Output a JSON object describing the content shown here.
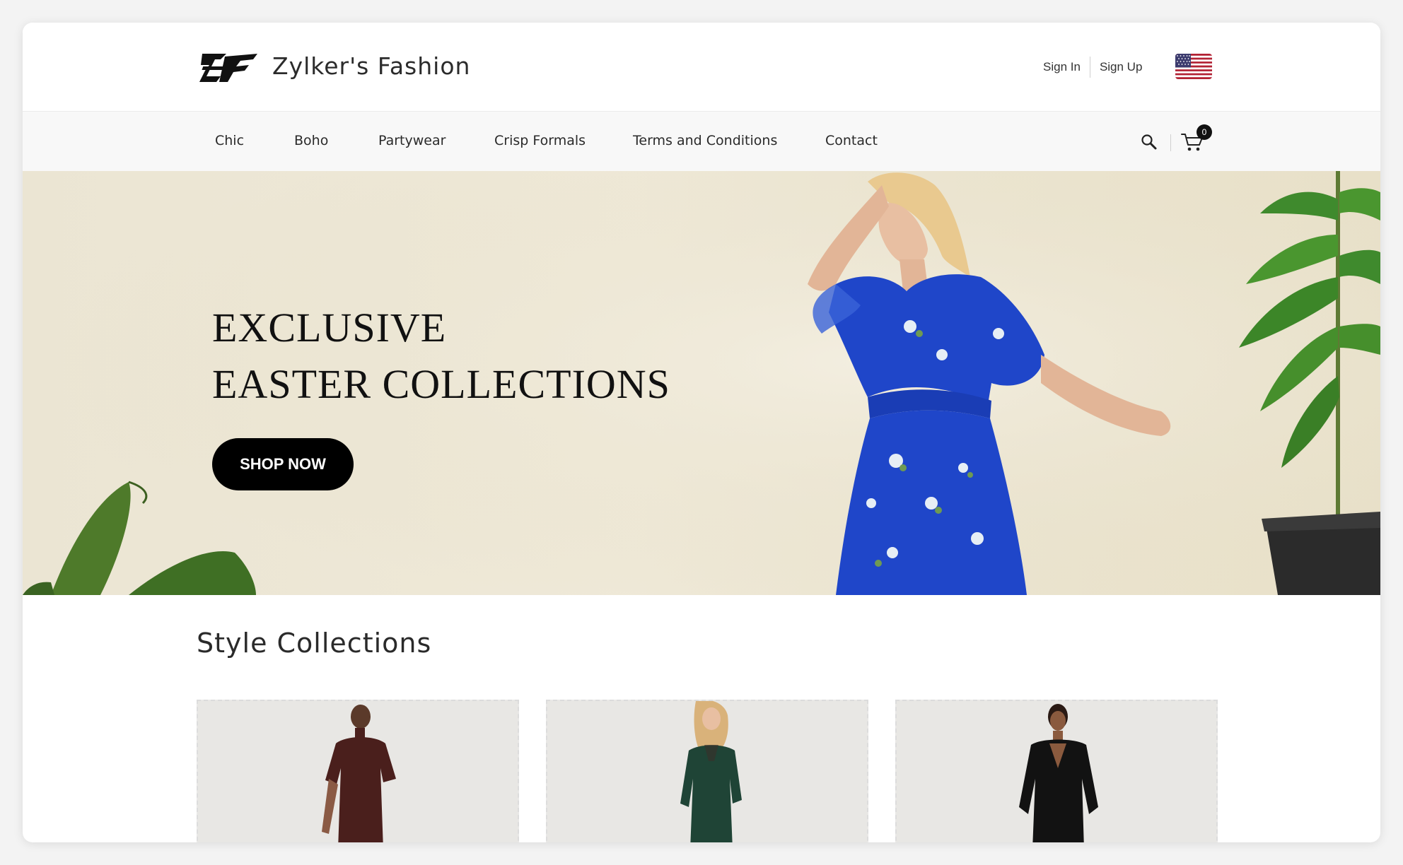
{
  "brand": {
    "name": "Zylker's Fashion",
    "logo_icon": "zf-monogram-logo"
  },
  "auth": {
    "sign_in": "Sign In",
    "sign_up": "Sign Up",
    "locale_icon": "us-flag-icon"
  },
  "nav": {
    "items": [
      {
        "label": "Chic"
      },
      {
        "label": "Boho"
      },
      {
        "label": "Partywear"
      },
      {
        "label": "Crisp Formals"
      },
      {
        "label": "Terms and Conditions"
      },
      {
        "label": "Contact"
      }
    ],
    "search_icon": "search-icon",
    "cart_icon": "cart-icon",
    "cart_count": "0"
  },
  "hero": {
    "title_line1": "EXCLUSIVE",
    "title_line2": "EASTER COLLECTIONS",
    "cta_label": "SHOP NOW"
  },
  "section": {
    "title": "Style Collections",
    "cards": [
      {
        "dress_color": "#4a1f1c"
      },
      {
        "dress_color": "#1f4436"
      },
      {
        "dress_color": "#111111"
      }
    ]
  },
  "colors": {
    "accent": "#000000",
    "hero_bg": "#ece6d4",
    "dress_blue": "#1f46c9"
  }
}
